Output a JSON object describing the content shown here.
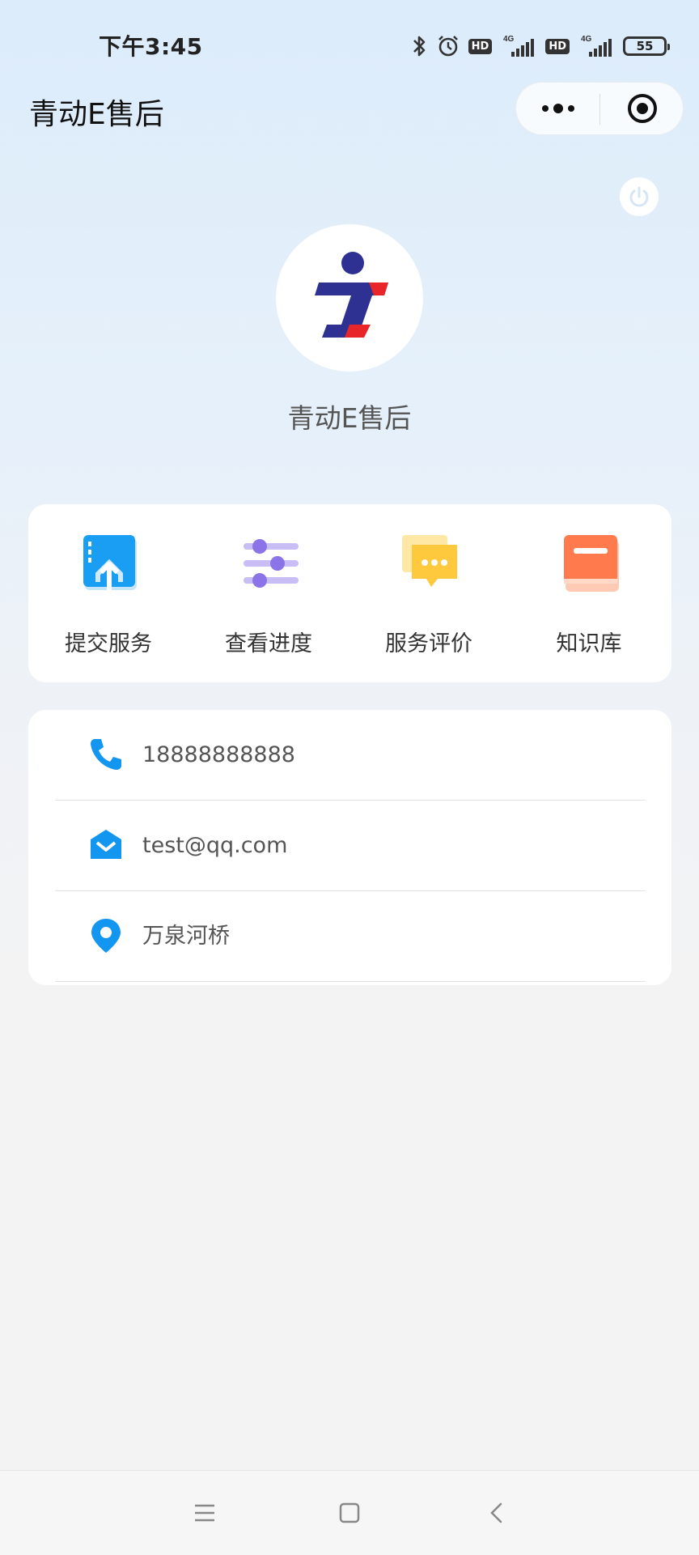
{
  "status_bar": {
    "time": "下午3:45",
    "hd_badge": "HD",
    "network": "4G",
    "battery": "55"
  },
  "nav": {
    "title": "青动E售后"
  },
  "profile": {
    "name": "青动E售后"
  },
  "menu": [
    {
      "label": "提交服务",
      "icon": "upload-icon"
    },
    {
      "label": "查看进度",
      "icon": "sliders-icon"
    },
    {
      "label": "服务评价",
      "icon": "chat-bubble-icon"
    },
    {
      "label": "知识库",
      "icon": "book-icon"
    }
  ],
  "contact": {
    "phone": "18888888888",
    "email": "test@qq.com",
    "address": "万泉河桥"
  },
  "colors": {
    "accent_blue": "#1296f0",
    "purple": "#8b74e8",
    "yellow": "#ffc93d",
    "orange": "#ff7a4c",
    "logo_blue": "#2e3192",
    "logo_red": "#e8262a"
  }
}
